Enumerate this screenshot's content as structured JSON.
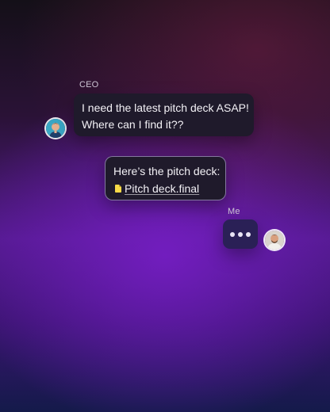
{
  "conversation": {
    "ceo": {
      "sender": "CEO",
      "avatar": "ceo-avatar",
      "message_lines": [
        "I need the latest pitch deck ASAP!",
        "Where can I find it??"
      ]
    },
    "reply": {
      "text": "Here’s the pitch deck:",
      "file_icon": "document-icon",
      "file_name": "Pitch deck.final"
    },
    "me": {
      "sender": "Me",
      "avatar": "me-avatar",
      "typing_indicator": "typing-dots"
    }
  },
  "colors": {
    "bubble": "#1f1a2b",
    "typing_bubble": "#2a2056",
    "file_icon": "#f7d948",
    "accent_border": "#d7c8ff"
  }
}
